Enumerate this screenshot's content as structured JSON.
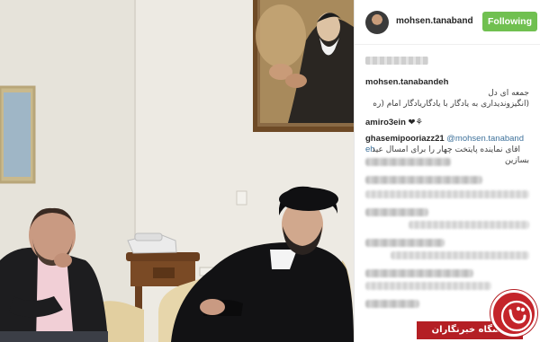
{
  "post": {
    "username": "mohsen.tanabandeh",
    "follow_button": "Following",
    "colors": {
      "follow": "#70c050",
      "username": "#262626",
      "mention": "#3f729b",
      "watermark": "#b41f24"
    }
  },
  "comments": [
    {
      "user": "mohsen.tanabandeh",
      "lines": [
        "جمعه ای دل",
        "(انگیزوندیداری به یادگار با یادگاریادگار امام (ره"
      ]
    },
    {
      "user": "amiro3ein",
      "suffix": "❤⚘"
    },
    {
      "user": "ghasemipooriazz21",
      "mention": "@mohsen.tanaband",
      "mention_cont": "eh",
      "lines": [
        "اقای نماینده پایتخت چهار را برای امسال عید",
        "بسازین"
      ]
    }
  ],
  "watermark": {
    "text": "باشگاه خبرنگاران",
    "logo": "ybc-logo-icon"
  }
}
